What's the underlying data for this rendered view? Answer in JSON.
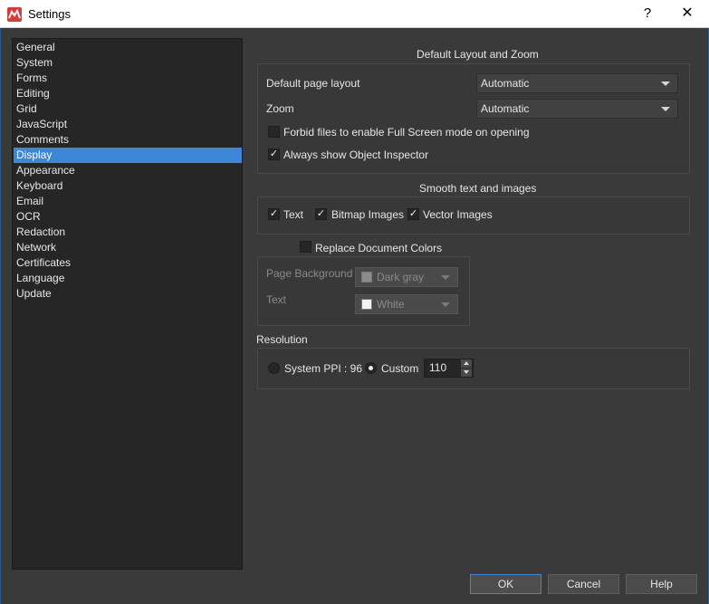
{
  "window": {
    "title": "Settings",
    "help_glyph": "?",
    "close_glyph": "✕"
  },
  "sidebar": {
    "items": [
      {
        "label": "General"
      },
      {
        "label": "System"
      },
      {
        "label": "Forms"
      },
      {
        "label": "Editing"
      },
      {
        "label": "Grid"
      },
      {
        "label": "JavaScript"
      },
      {
        "label": "Comments"
      },
      {
        "label": "Display"
      },
      {
        "label": "Appearance"
      },
      {
        "label": "Keyboard"
      },
      {
        "label": "Email"
      },
      {
        "label": "OCR"
      },
      {
        "label": "Redaction"
      },
      {
        "label": "Network"
      },
      {
        "label": "Certificates"
      },
      {
        "label": "Language"
      },
      {
        "label": "Update"
      }
    ],
    "selected": "Display"
  },
  "layout_zoom": {
    "title": "Default Layout and Zoom",
    "page_layout_label": "Default page layout",
    "page_layout_value": "Automatic",
    "zoom_label": "Zoom",
    "zoom_value": "Automatic",
    "forbid_fullscreen_label": "Forbid files to enable Full Screen mode on opening",
    "forbid_fullscreen_checked": false,
    "object_inspector_label": "Always show Object Inspector",
    "object_inspector_checked": true
  },
  "smooth": {
    "title": "Smooth text and images",
    "text_label": "Text",
    "text_checked": true,
    "bitmap_label": "Bitmap Images",
    "bitmap_checked": true,
    "vector_label": "Vector Images",
    "vector_checked": true
  },
  "replace_colors": {
    "label": "Replace Document Colors",
    "checked": false,
    "page_bg_label": "Page Background",
    "page_bg_value": "Dark gray",
    "page_bg_color": "#8c8c8c",
    "text_label": "Text",
    "text_value": "White",
    "text_color": "#f2f2f2"
  },
  "resolution": {
    "title": "Resolution",
    "system_label": "System PPI : 96",
    "custom_label": "Custom",
    "selected": "Custom",
    "custom_value": "110"
  },
  "footer": {
    "ok": "OK",
    "cancel": "Cancel",
    "help": "Help"
  },
  "icons": {
    "app": "app-logo-icon",
    "check": "✓"
  },
  "colors": {
    "accent": "#3d86d8",
    "background": "#3a3a3a",
    "sidebar": "#262626"
  }
}
